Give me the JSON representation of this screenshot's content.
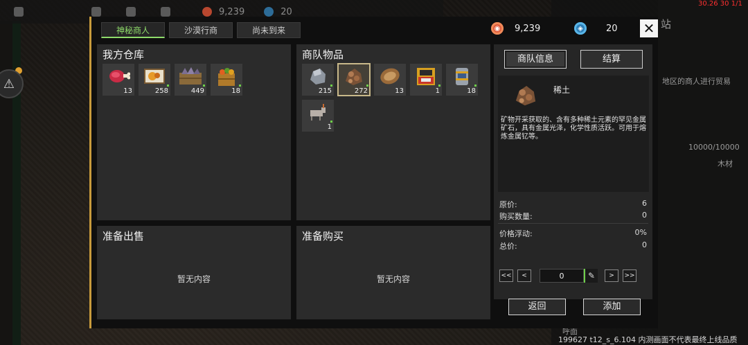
{
  "hud": {
    "gold": "9,239",
    "gems": "20",
    "debug": "30.26 30 1/1",
    "version": "199627 t12_s_6.104 内测画面不代表最终上线品质",
    "side_text_1": "站",
    "side_text_2": "地区的商人进行贸易",
    "side_text_3": "10000/10000",
    "side_text_4": "木材",
    "side_text_5": "呼面"
  },
  "tabs": [
    {
      "label": "神秘商人",
      "active": true
    },
    {
      "label": "沙漠行商",
      "active": false
    },
    {
      "label": "尚未到来",
      "active": false
    }
  ],
  "currency": {
    "gold_value": "9,239",
    "gem_value": "20"
  },
  "warehouse": {
    "title": "我方仓库",
    "items": [
      {
        "icon": "meat-icon",
        "count": "13"
      },
      {
        "icon": "meal-plate-icon",
        "count": "258"
      },
      {
        "icon": "stone-crate-icon",
        "count": "449"
      },
      {
        "icon": "fruit-crate-icon",
        "count": "18"
      }
    ]
  },
  "caravan": {
    "title": "商队物品",
    "items": [
      {
        "icon": "iron-ore-icon",
        "count": "215"
      },
      {
        "icon": "rare-earth-icon",
        "count": "272",
        "selected": true
      },
      {
        "icon": "wood-log-icon",
        "count": "13"
      },
      {
        "icon": "machine-icon",
        "count": "1"
      },
      {
        "icon": "canister-icon",
        "count": "18"
      },
      {
        "icon": "donkey-icon",
        "count": "1"
      }
    ]
  },
  "sell": {
    "title": "准备出售",
    "empty": "暂无内容"
  },
  "buy": {
    "title": "准备购买",
    "empty": "暂无内容"
  },
  "info": {
    "tab_info": "商队信息",
    "tab_settle": "结算",
    "item_name": "稀土",
    "item_desc": "矿物开采获取的、含有多种稀土元素的罕见金属矿石，具有金属光泽，化学性质活跃。可用于熔炼金属钇等。",
    "price_label": "原价:",
    "price_value": "6",
    "qty_label": "购买数量:",
    "qty_value": "0",
    "float_label": "价格浮动:",
    "float_value": "0%",
    "total_label": "总价:",
    "total_value": "0",
    "stepper_value": "0",
    "btn_first": "<<",
    "btn_prev": "<",
    "btn_next": ">",
    "btn_last": ">>"
  },
  "actions": {
    "back": "返回",
    "add": "添加"
  }
}
